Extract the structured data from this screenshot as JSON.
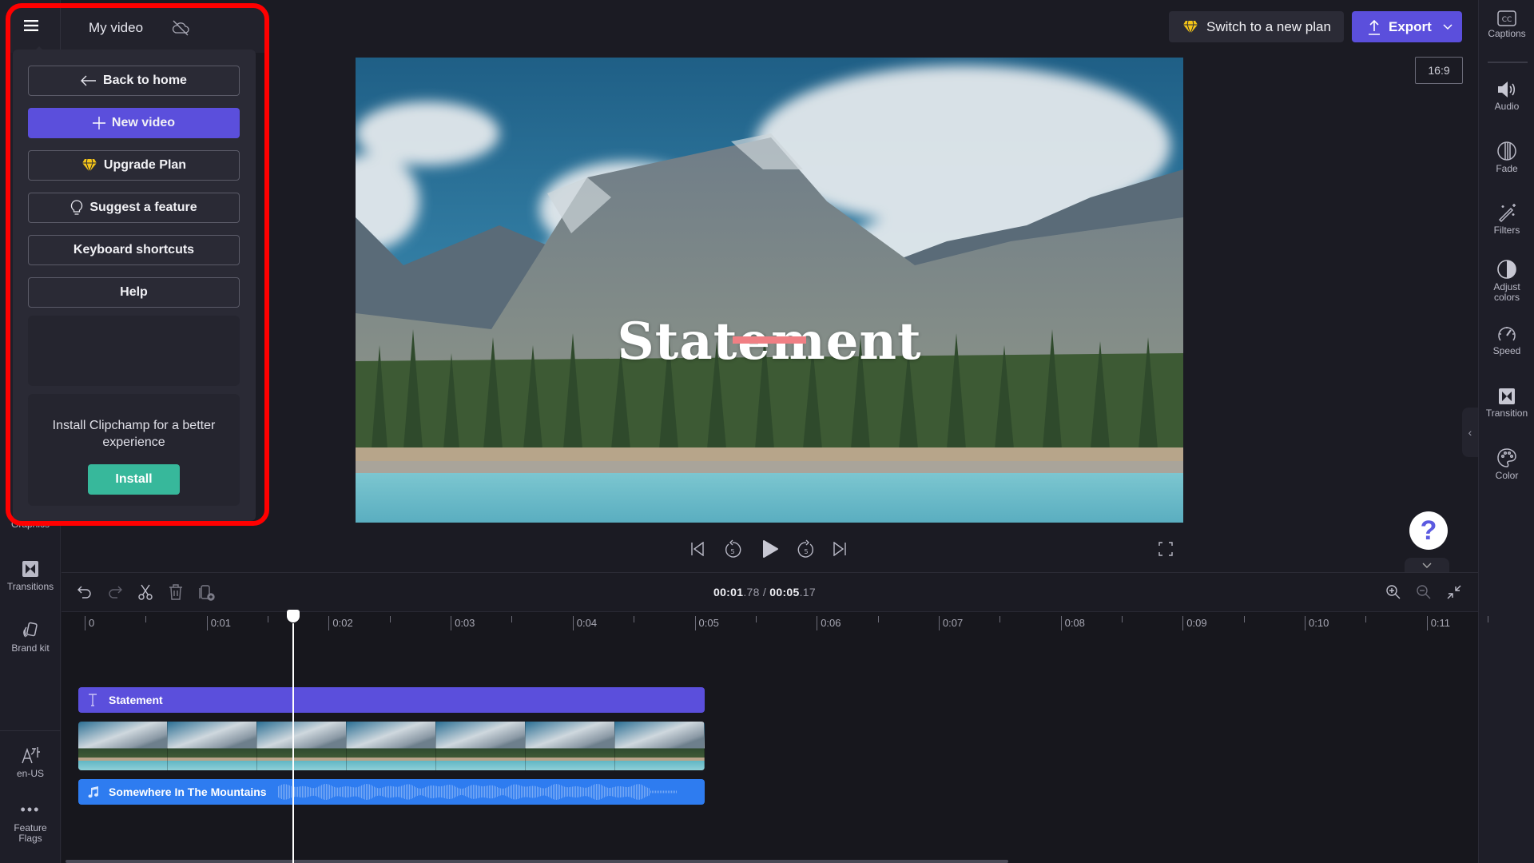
{
  "header": {
    "project_title": "My video",
    "cloud_status_icon": "cloud-off-icon",
    "switch_plan_label": "Switch to a new plan",
    "export_label": "Export",
    "aspect_ratio": "16:9"
  },
  "menu": {
    "items": [
      {
        "label": "Back to home",
        "icon": "arrow-left-icon"
      },
      {
        "label": "New video",
        "icon": "plus-icon"
      },
      {
        "label": "Upgrade Plan",
        "icon": "diamond-icon"
      },
      {
        "label": "Suggest a feature",
        "icon": "lightbulb-icon"
      },
      {
        "label": "Keyboard shortcuts",
        "icon": ""
      },
      {
        "label": "Help",
        "icon": ""
      }
    ],
    "install_text": "Install Clipchamp for a better experience",
    "install_label": "Install"
  },
  "left_rail": {
    "items": [
      {
        "label": "Graphics",
        "icon": "graphics-icon"
      },
      {
        "label": "Transitions",
        "icon": "transitions-icon"
      },
      {
        "label": "Brand kit",
        "icon": "brand-kit-icon"
      },
      {
        "label": "en-US",
        "icon": "language-icon"
      },
      {
        "label": "Feature Flags",
        "icon": "more-icon"
      }
    ]
  },
  "right_rail": {
    "items": [
      {
        "label": "Captions",
        "icon": "captions-icon"
      },
      {
        "label": "Audio",
        "icon": "speaker-icon"
      },
      {
        "label": "Fade",
        "icon": "fade-icon"
      },
      {
        "label": "Filters",
        "icon": "magic-wand-icon"
      },
      {
        "label": "Adjust colors",
        "icon": "contrast-icon"
      },
      {
        "label": "Speed",
        "icon": "speedometer-icon"
      },
      {
        "label": "Transition",
        "icon": "transition-icon"
      },
      {
        "label": "Color",
        "icon": "palette-icon"
      }
    ]
  },
  "preview": {
    "overlay_text": "Statement",
    "accent_bar_color": "#f07f84"
  },
  "playback": {
    "skip_back_seconds": "5",
    "skip_forward_seconds": "5",
    "help_label": "?"
  },
  "timeline": {
    "current_time_main": "00:01",
    "current_time_frac": ".78",
    "separator": " / ",
    "total_time_main": "00:05",
    "total_time_frac": ".17",
    "ruler_labels": [
      "0",
      "0:01",
      "0:02",
      "0:03",
      "0:04",
      "0:05",
      "0:06",
      "0:07",
      "0:08",
      "0:09",
      "0:10",
      "0:11"
    ],
    "playhead_seconds": 1.78,
    "tracks": {
      "text_clip": "Statement",
      "audio_clip": "Somewhere In The Mountains",
      "video_frames": 7
    }
  },
  "colors": {
    "accent": "#5b4fdc",
    "install": "#37b89b",
    "audio_clip": "#2e7cf0",
    "highlight_border": "#ff0000",
    "premium_gold": "#f5c518"
  }
}
